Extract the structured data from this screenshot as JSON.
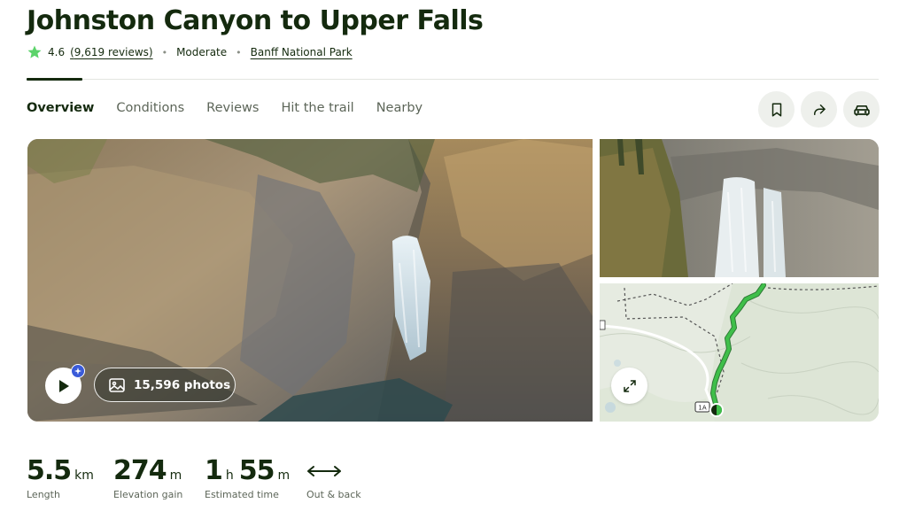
{
  "header": {
    "title": "Johnston Canyon to Upper Falls",
    "rating": "4.6",
    "reviews": "9,619 reviews",
    "difficulty": "Moderate",
    "park": "Banff National Park",
    "star_color": "#5bd36a"
  },
  "tabs": [
    {
      "label": "Overview",
      "active": true
    },
    {
      "label": "Conditions"
    },
    {
      "label": "Reviews"
    },
    {
      "label": "Hit the trail"
    },
    {
      "label": "Nearby"
    }
  ],
  "actions": [
    {
      "icon": "bookmark-icon"
    },
    {
      "icon": "share-icon"
    },
    {
      "icon": "car-icon"
    }
  ],
  "gallery": {
    "photos_label": "15,596 photos",
    "route_marker": "1A",
    "trail_color": "#3fbf4a"
  },
  "stats": {
    "length": {
      "value": "5.5",
      "unit": "km",
      "label": "Length"
    },
    "elevation": {
      "value": "274",
      "unit": "m",
      "label": "Elevation gain"
    },
    "time": {
      "hours": "1",
      "hours_unit": "h",
      "minutes": "55",
      "minutes_unit": "m",
      "label": "Estimated time"
    },
    "route": {
      "icon": "out-and-back-icon",
      "label": "Out & back"
    }
  }
}
